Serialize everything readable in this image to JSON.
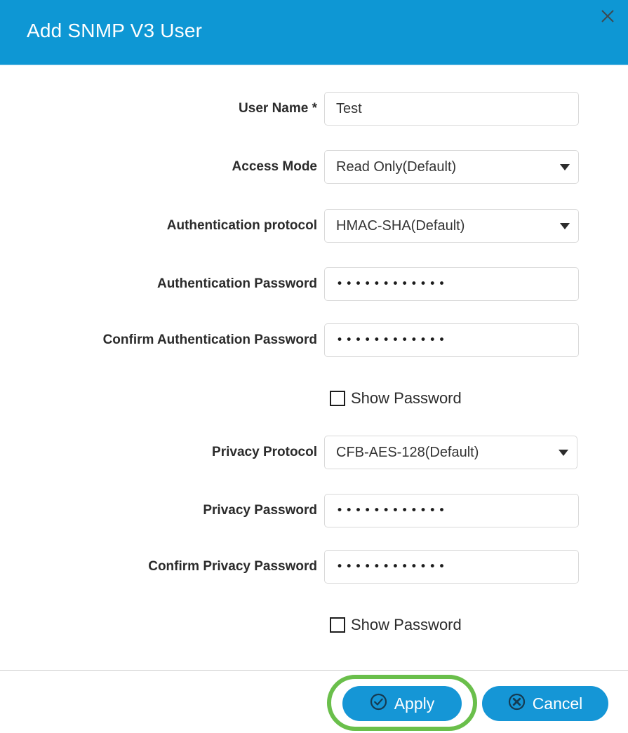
{
  "dialog": {
    "title": "Add SNMP V3 User",
    "close_icon": "close-icon"
  },
  "form": {
    "fields": [
      {
        "label": "User Name *",
        "type": "text",
        "value": "Test",
        "placeholder": ""
      },
      {
        "label": "Access Mode",
        "type": "select",
        "value": "Read Only(Default)"
      },
      {
        "label": "Authentication protocol",
        "type": "select",
        "value": "HMAC-SHA(Default)"
      },
      {
        "label": "Authentication Password",
        "type": "password",
        "value": "••••••••••••"
      },
      {
        "label": "Confirm Authentication Password",
        "type": "password",
        "value": "••••••••••••"
      },
      {
        "label": "Privacy Protocol",
        "type": "select",
        "value": "CFB-AES-128(Default)"
      },
      {
        "label": "Privacy Password",
        "type": "password",
        "value": "••••••••••••"
      },
      {
        "label": "Confirm Privacy Password",
        "type": "password",
        "value": "••••••••••••"
      }
    ],
    "show_password_auth": "Show Password",
    "show_password_privacy": "Show Password"
  },
  "footer": {
    "apply_label": "Apply",
    "apply_icon": "check-circle-icon",
    "cancel_label": "Cancel",
    "cancel_icon": "x-circle-icon"
  },
  "colors": {
    "header_blue": "#0e97d4",
    "button_blue": "#1596d6",
    "annotation_green": "#6abf4b",
    "field_border": "#d9d9d9",
    "text_dark": "#2b2b2b"
  }
}
